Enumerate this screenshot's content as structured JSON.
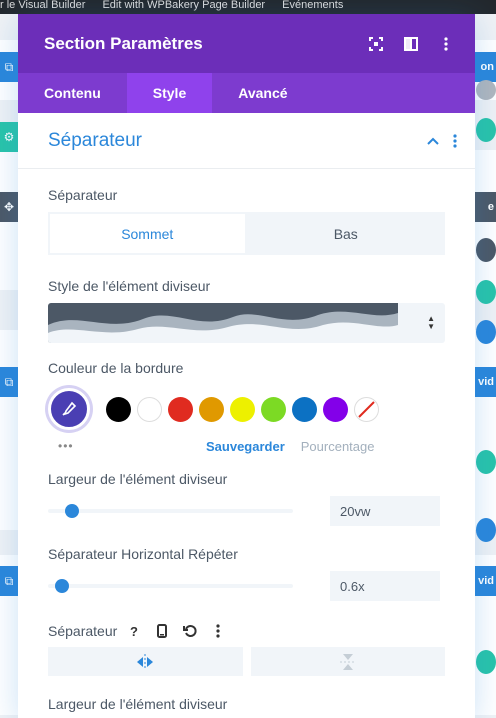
{
  "wp_admin_bar": [
    "r le Visual Builder",
    "Edit with WPBakery Page Builder",
    "Événements"
  ],
  "background": {
    "right_tab_labels": [
      "on",
      "e",
      "vid",
      "vid"
    ]
  },
  "modal": {
    "title": "Section Paramètres",
    "header_icons": [
      "expand-icon",
      "split-view-icon",
      "more-options-icon"
    ],
    "tabs": [
      {
        "label": "Contenu",
        "active": false
      },
      {
        "label": "Style",
        "active": true
      },
      {
        "label": "Avancé",
        "active": false
      }
    ],
    "toggle_title": "Séparateur",
    "separator": {
      "label": "Séparateur",
      "options": [
        {
          "label": "Sommet",
          "selected": true
        },
        {
          "label": "Bas",
          "selected": false
        }
      ]
    },
    "divider_style": {
      "label": "Style de l'élément diviseur"
    },
    "border_color": {
      "label": "Couleur de la bordure",
      "swatches": [
        "#000000",
        "#ffffff",
        "#e02b20",
        "#e09900",
        "#edf000",
        "#7cda24",
        "#0c71c3",
        "#8300e9"
      ],
      "save_label": "Sauvegarder",
      "percent_label": "Pourcentage",
      "accent": "#2b87da"
    },
    "divider_width": {
      "label": "Largeur de l'élément diviseur",
      "value": "20vw",
      "slider_fraction": 0.07
    },
    "horizontal_repeat": {
      "label": "Séparateur Horizontal Répéter",
      "value": "0.6x",
      "slider_fraction": 0.03
    },
    "flip": {
      "label": "Séparateur",
      "icons": [
        "help-icon",
        "mobile-icon",
        "reset-icon",
        "more-icon"
      ]
    },
    "next_label": "Largeur de l'élément diviseur"
  },
  "colors": {
    "header": "#6c2eb9",
    "tabs": "#7d3bcf",
    "tab_active": "#8f42ec",
    "accent": "#2b87da"
  }
}
